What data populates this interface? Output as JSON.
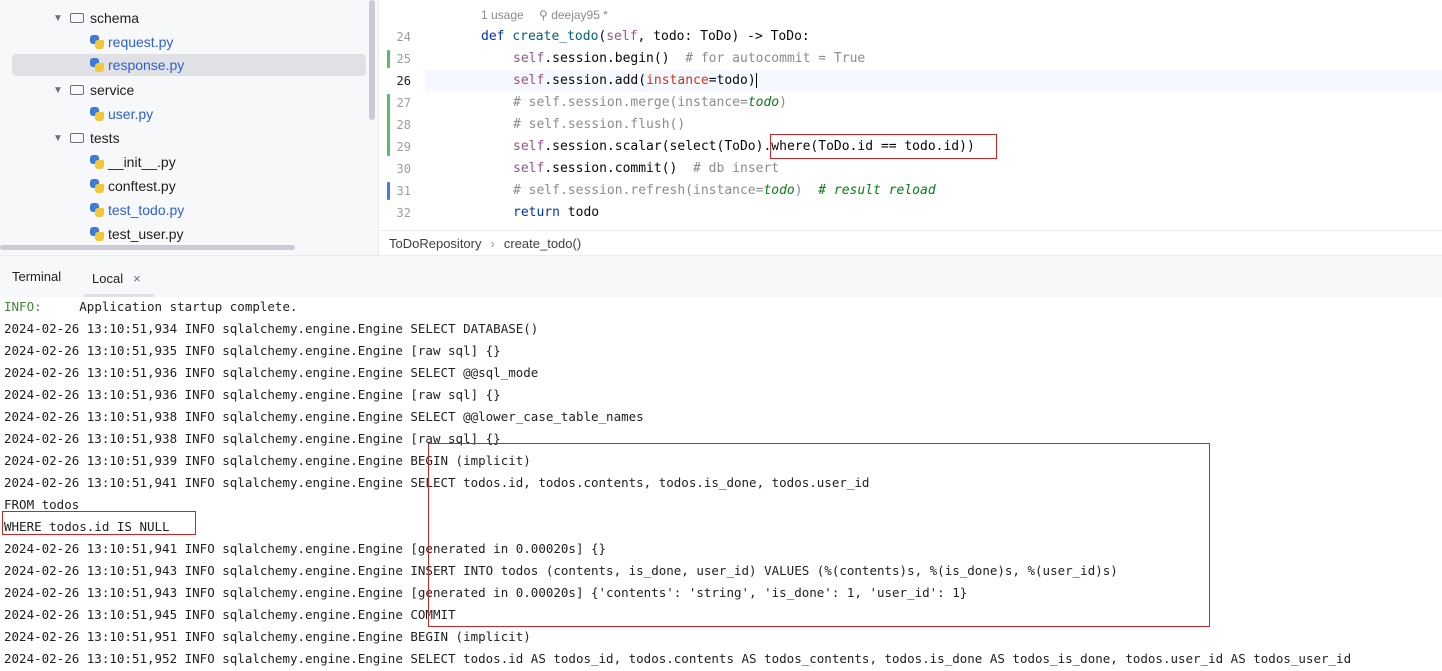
{
  "project_tree": {
    "items": [
      {
        "label": "schema",
        "kind": "folder"
      },
      {
        "label": "request.py",
        "kind": "file"
      },
      {
        "label": "response.py",
        "kind": "file"
      },
      {
        "label": "service",
        "kind": "folder"
      },
      {
        "label": "user.py",
        "kind": "file"
      },
      {
        "label": "tests",
        "kind": "folder"
      },
      {
        "label": "__init__.py",
        "kind": "file"
      },
      {
        "label": "conftest.py",
        "kind": "file"
      },
      {
        "label": "test_todo.py",
        "kind": "file"
      },
      {
        "label": "test_user.py",
        "kind": "file"
      }
    ]
  },
  "editor": {
    "inlay_usage": "1 usage",
    "inlay_author": "deejay95 *",
    "line_numbers": [
      "24",
      "25",
      "26",
      "27",
      "28",
      "29",
      "30",
      "31",
      "32"
    ],
    "lines": {
      "l24": {
        "kw": "def",
        "fn": "create_todo",
        "p1": "(",
        "self": "self",
        "rest": ", todo: ToDo) -> ToDo:"
      },
      "l25": {
        "self": "self",
        "code": ".session.begin()  ",
        "comment": "# for autocommit = True"
      },
      "l26": {
        "self": "self",
        "code": ".session.add(",
        "named": "instance",
        "rest": "=todo)"
      },
      "l27": {
        "comment": "# self.session.merge(instance=",
        "italic": "todo",
        "close": ")"
      },
      "l28": {
        "comment": "# self.session.flush()"
      },
      "l29": {
        "self": "self",
        "code": ".session.scalar(select(ToDo)",
        "highlight": ".where(ToDo.id == todo.id))"
      },
      "l30": {
        "self": "self",
        "code": ".session.commit()  ",
        "comment": "# db insert"
      },
      "l31": {
        "comment": "# self.session.refresh(instance=",
        "italic": "todo",
        "close": ")  ",
        "italic2": "# result reload"
      },
      "l32": {
        "kw": "return",
        "rest": " todo"
      }
    },
    "breadcrumb": [
      "ToDoRepository",
      "create_todo()"
    ]
  },
  "terminal": {
    "tab_title": "Terminal",
    "tab_local": "Local",
    "close_glyph": "×",
    "lines": [
      {
        "prefix": "INFO:",
        "text": "     Application startup complete."
      },
      {
        "text": "2024-02-26 13:10:51,934 INFO sqlalchemy.engine.Engine SELECT DATABASE()"
      },
      {
        "text": "2024-02-26 13:10:51,935 INFO sqlalchemy.engine.Engine [raw sql] {}"
      },
      {
        "text": "2024-02-26 13:10:51,936 INFO sqlalchemy.engine.Engine SELECT @@sql_mode"
      },
      {
        "text": "2024-02-26 13:10:51,936 INFO sqlalchemy.engine.Engine [raw sql] {}"
      },
      {
        "text": "2024-02-26 13:10:51,938 INFO sqlalchemy.engine.Engine SELECT @@lower_case_table_names"
      },
      {
        "text": "2024-02-26 13:10:51,938 INFO sqlalchemy.engine.Engine [raw sql] {}"
      },
      {
        "text": "2024-02-26 13:10:51,939 INFO sqlalchemy.engine.Engine BEGIN (implicit)"
      },
      {
        "text": "2024-02-26 13:10:51,941 INFO sqlalchemy.engine.Engine SELECT todos.id, todos.contents, todos.is_done, todos.user_id"
      },
      {
        "text": "FROM todos"
      },
      {
        "text": "WHERE todos.id IS NULL"
      },
      {
        "text": "2024-02-26 13:10:51,941 INFO sqlalchemy.engine.Engine [generated in 0.00020s] {}"
      },
      {
        "text": "2024-02-26 13:10:51,943 INFO sqlalchemy.engine.Engine INSERT INTO todos (contents, is_done, user_id) VALUES (%(contents)s, %(is_done)s, %(user_id)s)"
      },
      {
        "text": "2024-02-26 13:10:51,943 INFO sqlalchemy.engine.Engine [generated in 0.00020s] {'contents': 'string', 'is_done': 1, 'user_id': 1}"
      },
      {
        "text": "2024-02-26 13:10:51,945 INFO sqlalchemy.engine.Engine COMMIT"
      },
      {
        "text": "2024-02-26 13:10:51,951 INFO sqlalchemy.engine.Engine BEGIN (implicit)"
      },
      {
        "text": "2024-02-26 13:10:51,952 INFO sqlalchemy.engine.Engine SELECT todos.id AS todos_id, todos.contents AS todos_contents, todos.is_done AS todos_is_done, todos.user_id AS todos_user_id"
      }
    ]
  },
  "colors": {
    "highlight_box": "#c62828",
    "added_marker": "#5fb865",
    "modified_marker": "#4a7ad6",
    "info_green": "#3e8b33"
  }
}
